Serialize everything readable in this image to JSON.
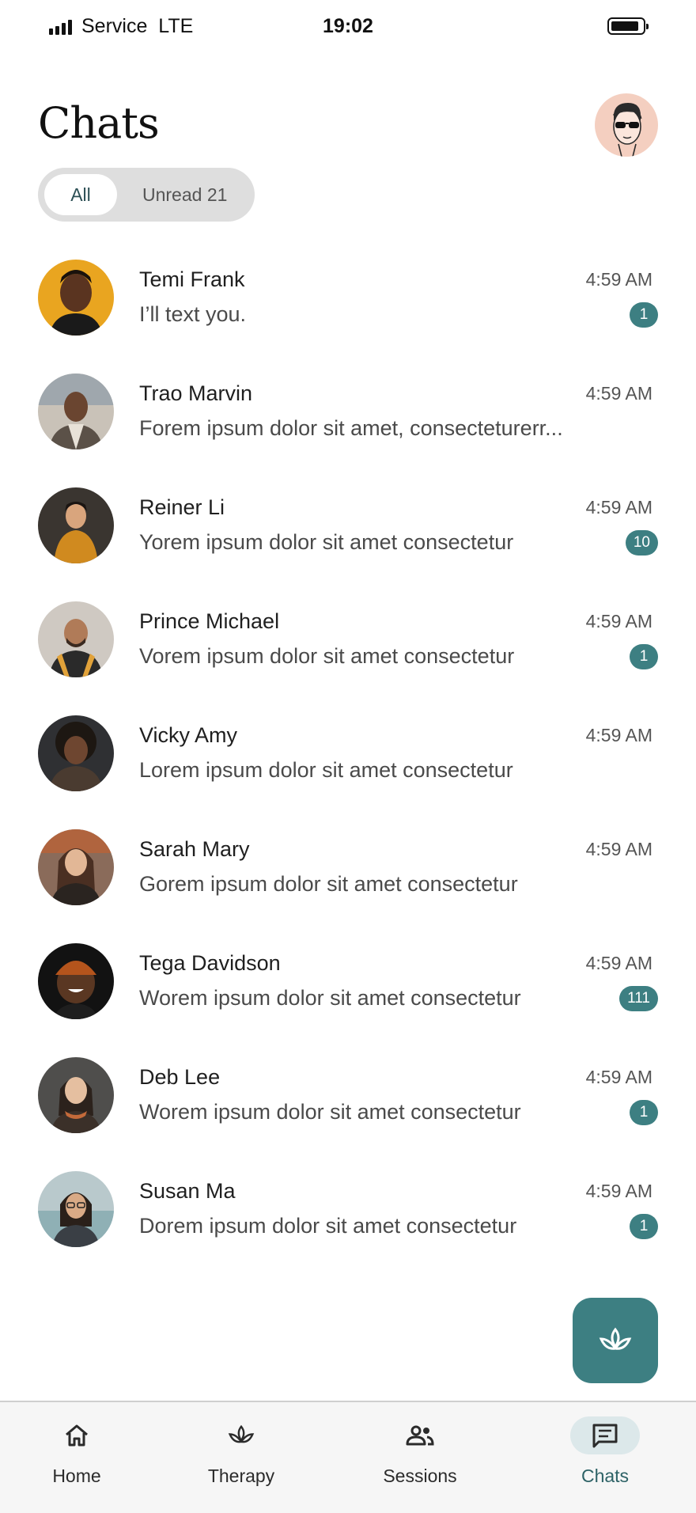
{
  "status_bar": {
    "carrier": "Service",
    "network": "LTE",
    "time": "19:02"
  },
  "header": {
    "title": "Chats"
  },
  "filter": {
    "all_label": "All",
    "unread_label": "Unread 21",
    "selected": "All"
  },
  "chats": [
    {
      "name": "Temi Frank",
      "preview": "I’ll text you.",
      "time": "4:59 AM",
      "badge": "1"
    },
    {
      "name": "Trao Marvin",
      "preview": "Forem ipsum dolor sit amet, consecteturerr...",
      "time": "4:59 AM",
      "badge": ""
    },
    {
      "name": "Reiner Li",
      "preview": "Yorem ipsum dolor sit amet consectetur",
      "time": "4:59 AM",
      "badge": "10"
    },
    {
      "name": "Prince Michael",
      "preview": "Vorem ipsum dolor sit amet consectetur",
      "time": "4:59 AM",
      "badge": "1"
    },
    {
      "name": "Vicky Amy",
      "preview": "Lorem ipsum dolor sit amet consectetur",
      "time": "4:59 AM",
      "badge": ""
    },
    {
      "name": "Sarah Mary",
      "preview": "Gorem ipsum dolor sit amet consectetur",
      "time": "4:59 AM",
      "badge": ""
    },
    {
      "name": "Tega Davidson",
      "preview": "Worem ipsum dolor sit amet consectetur",
      "time": "4:59 AM",
      "badge": "111"
    },
    {
      "name": "Deb Lee",
      "preview": "Worem ipsum dolor sit amet consectetur",
      "time": "4:59 AM",
      "badge": "1"
    },
    {
      "name": "Susan Ma",
      "preview": "Dorem ipsum dolor sit amet consectetur",
      "time": "4:59 AM",
      "badge": "1"
    }
  ],
  "fab": {
    "icon": "lotus-icon"
  },
  "bottom_nav": [
    {
      "label": "Home",
      "icon": "home-icon"
    },
    {
      "label": "Therapy",
      "icon": "lotus-icon"
    },
    {
      "label": "Sessions",
      "icon": "people-icon"
    },
    {
      "label": "Chats",
      "icon": "chat-icon",
      "active": true
    }
  ],
  "colors": {
    "accent": "#3d7f82",
    "badge": "#3d7f82",
    "nav_active_bg": "#dce8ea",
    "filter_bg": "#dedede"
  }
}
